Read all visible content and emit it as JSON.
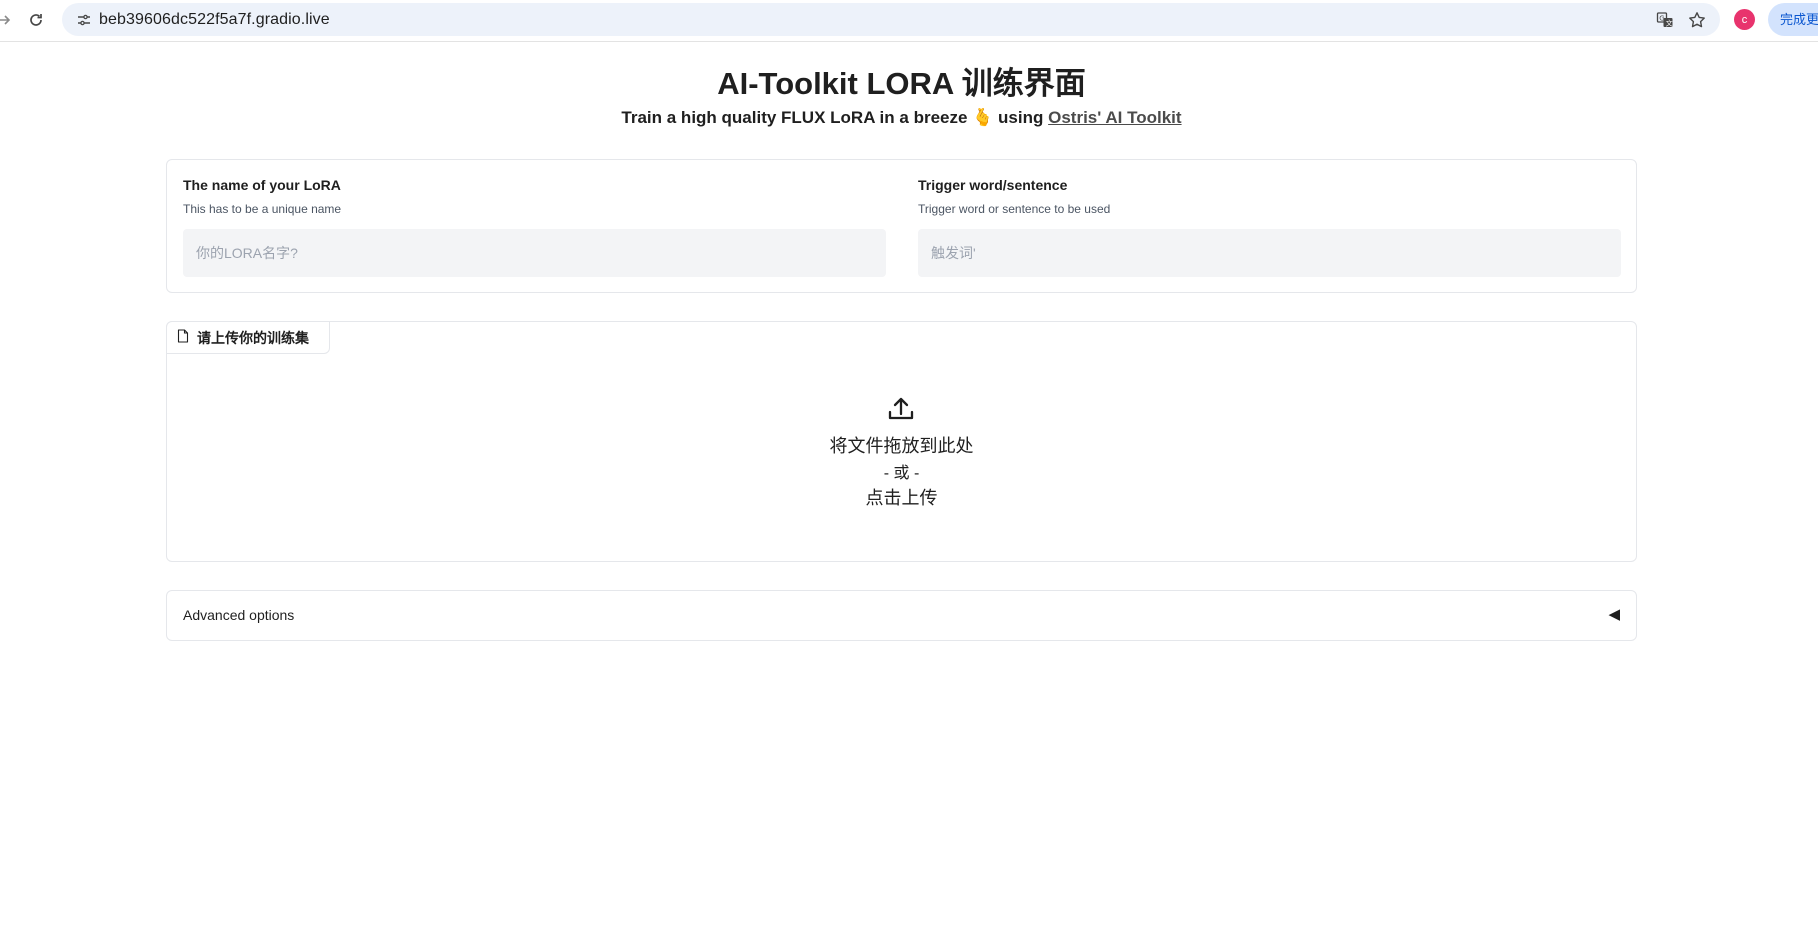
{
  "browser": {
    "url": "beb39606dc522f5a7f.gradio.live",
    "avatar_letter": "c",
    "update_button_label": "完成更新",
    "icons": [
      "forward-icon",
      "reload-icon",
      "site-info-icon",
      "translate-icon",
      "bookmark-star-icon"
    ],
    "avatar_color": "#e8336d"
  },
  "page": {
    "title": "AI-Toolkit LORA 训练界面",
    "subtitle_prefix": "Train a high quality FLUX LoRA in a breeze 🫰 using",
    "subtitle_link": "Ostris' AI Toolkit"
  },
  "lora_name": {
    "label": "The name of your LoRA",
    "info": "This has to be a unique name",
    "value": "",
    "placeholder": "你的LORA名字?"
  },
  "trigger": {
    "label": "Trigger word/sentence",
    "info": "Trigger word or sentence to be used",
    "value": "",
    "placeholder": "触发词'"
  },
  "upload": {
    "tab_label": "请上传你的训练集",
    "drop_text": "将文件拖放到此处",
    "or_text": "- 或 -",
    "click_text": "点击上传"
  },
  "advanced": {
    "label": "Advanced options",
    "toggle": "◀"
  }
}
